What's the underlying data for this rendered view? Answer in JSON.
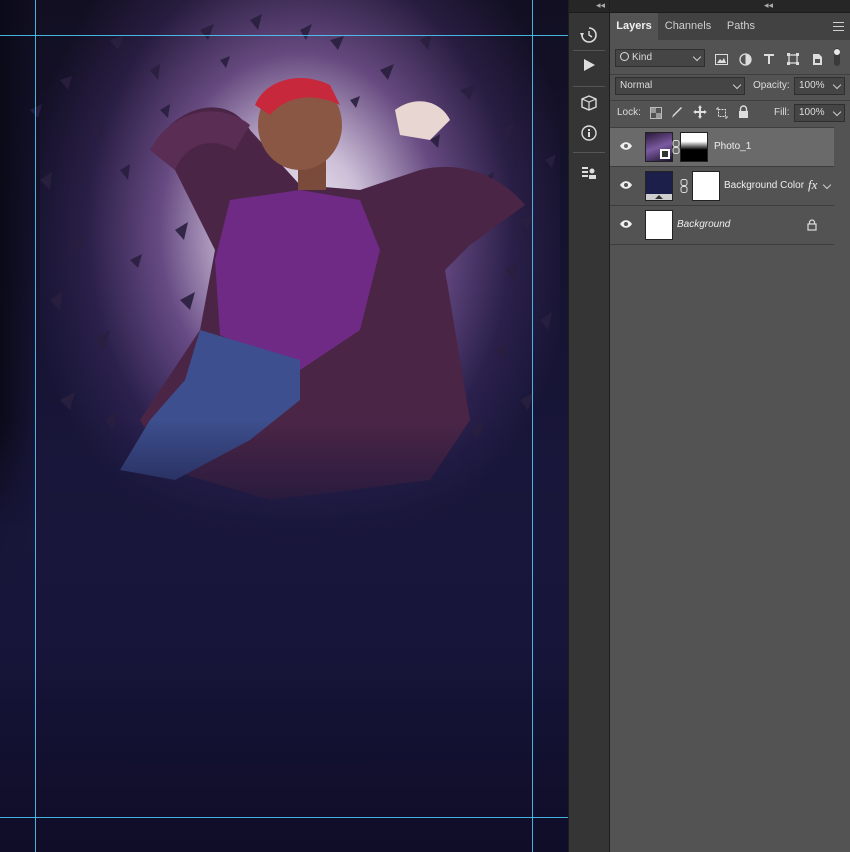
{
  "toolbar": {
    "collapse_left": "◂◂",
    "collapse_right": "◂◂",
    "tools": [
      "history-brush-icon",
      "play-icon",
      "3d-cube-icon",
      "info-icon",
      "stamp-icon"
    ]
  },
  "panel": {
    "tabs": [
      {
        "label": "Layers",
        "active": true
      },
      {
        "label": "Channels",
        "active": false
      },
      {
        "label": "Paths",
        "active": false
      }
    ],
    "filter": {
      "label": "Kind",
      "icons": [
        "image-filter-icon",
        "adjustment-filter-icon",
        "type-filter-icon",
        "shape-filter-icon",
        "smart-object-filter-icon",
        "filter-toggle-icon"
      ]
    },
    "blend_mode": "Normal",
    "opacity_label": "Opacity:",
    "opacity_value": "100%",
    "lock_label": "Lock:",
    "lock_icons": [
      "lock-transparent-icon",
      "lock-paint-icon",
      "lock-position-icon",
      "lock-artboard-icon",
      "lock-all-icon"
    ],
    "fill_label": "Fill:",
    "fill_value": "100%",
    "layers": [
      {
        "name": "Photo_1",
        "selected": true,
        "visible": true
      },
      {
        "name": "Background Color",
        "selected": false,
        "visible": true,
        "fx": "fx"
      },
      {
        "name": "Background",
        "selected": false,
        "visible": true,
        "locked": true
      }
    ]
  },
  "colors": {
    "guide": "#4ed0ff",
    "panel_bg": "#535353",
    "selected_layer": "#6a6a6a",
    "background_color_fill": "#1b1f4a"
  }
}
